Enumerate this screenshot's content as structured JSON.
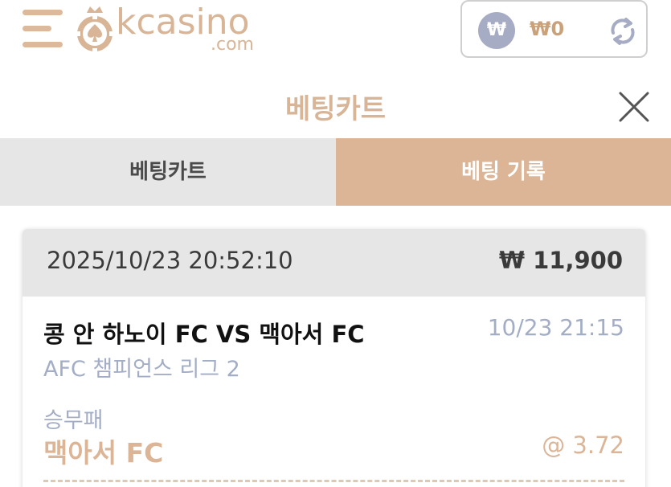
{
  "header": {
    "logo_text": "kcasino",
    "logo_sub": ".com",
    "wallet": {
      "currency_symbol": "₩",
      "balance": "₩0"
    }
  },
  "title": "베팅카트",
  "tabs": [
    {
      "label": "베팅카트",
      "active": false
    },
    {
      "label": "베팅 기록",
      "active": true
    }
  ],
  "bet": {
    "datetime": "2025/10/23 20:52:10",
    "amount": "₩ 11,900",
    "match": "콩 안 하노이 FC VS 맥아서 FC",
    "match_time": "10/23 21:15",
    "league": "AFC 챔피언스 리그 2",
    "market": "승무패",
    "pick": "맥아서 FC",
    "odds": "@ 3.72"
  },
  "colors": {
    "accent": "#dcb596",
    "muted_blue": "#a3aec6",
    "tab_inactive_bg": "#e6e6e6"
  }
}
